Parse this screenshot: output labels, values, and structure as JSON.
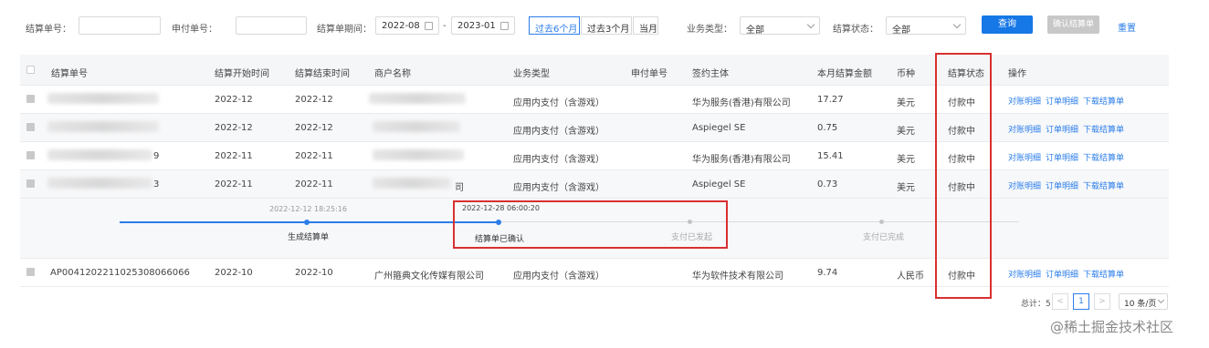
{
  "filters": {
    "settle_no_label": "结算单号：",
    "apply_no_label": "申付单号：",
    "period_label": "结算单期间：",
    "start_month": "2022-08",
    "range_sep": "-",
    "end_month": "2023-01",
    "quick_ranges": [
      "过去6个月",
      "过去3个月",
      "当月"
    ],
    "biz_type_label": "业务类型：",
    "biz_type_value": "全部",
    "status_label": "结算状态：",
    "status_value": "全部",
    "query_btn": "查询",
    "confirm_btn": "确认结算单",
    "reset_link": "重置"
  },
  "table": {
    "headers": [
      "结算单号",
      "结算开始时间",
      "结算结束时间",
      "商户名称",
      "业务类型",
      "申付单号",
      "签约主体",
      "本月结算金额",
      "币种",
      "结算状态",
      "操作"
    ],
    "rows": [
      {
        "id": "",
        "start": "2022-12",
        "end": "2022-12",
        "merchant": "",
        "biz": "应用内支付（含游戏）",
        "apply": "",
        "entity": "华为服务(香港)有限公司",
        "amount": "17.27",
        "currency": "美元",
        "status": "付款中"
      },
      {
        "id": "",
        "start": "2022-12",
        "end": "2022-12",
        "merchant": "",
        "biz": "应用内支付（含游戏）",
        "apply": "",
        "entity": "Aspiegel SE",
        "amount": "0.75",
        "currency": "美元",
        "status": "付款中"
      },
      {
        "id": "9",
        "start": "2022-11",
        "end": "2022-11",
        "merchant": "",
        "biz": "应用内支付（含游戏）",
        "apply": "",
        "entity": "华为服务(香港)有限公司",
        "amount": "15.41",
        "currency": "美元",
        "status": "付款中"
      },
      {
        "id": "3",
        "start": "2022-11",
        "end": "2022-11",
        "merchant": "司",
        "biz": "应用内支付（含游戏）",
        "apply": "",
        "entity": "Aspiegel SE",
        "amount": "0.73",
        "currency": "美元",
        "status": "付款中"
      }
    ],
    "last_row": {
      "id": "AP0041202211025308066066",
      "start": "2022-10",
      "end": "2022-10",
      "merchant": "广州箍典文化传媒有限公司",
      "biz": "应用内支付（含游戏）",
      "apply": "",
      "entity": "华为软件技术有限公司",
      "amount": "9.74",
      "currency": "人民币",
      "status": "付款中"
    },
    "ops": [
      "对账明细",
      "订单明细",
      "下载结算单"
    ]
  },
  "timeline": {
    "steps": [
      {
        "time": "2022-12-12 18:25:16",
        "label": "生成结算单"
      },
      {
        "time": "2022-12-28 06:00:20",
        "label": "结算单已确认"
      },
      {
        "time": "",
        "label": "支付已发起"
      },
      {
        "time": "",
        "label": "支付已完成"
      }
    ]
  },
  "pagination": {
    "total_label": "总计：5",
    "prev": "<",
    "current": "1",
    "next": ">",
    "page_size": "10 条/页"
  },
  "watermark": "@稀土掘金技术社区",
  "colors": {
    "primary": "#1677e6",
    "highlight": "#d93030"
  }
}
